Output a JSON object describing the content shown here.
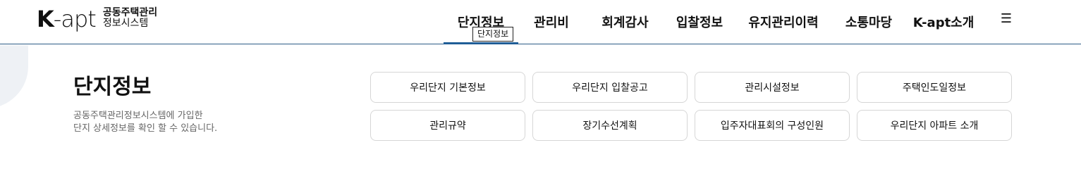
{
  "logo": {
    "mark_bold": "K",
    "mark_light": "-apt",
    "sub_line1": "공동주택관리",
    "sub_line2": "정보시스템"
  },
  "nav": {
    "items": [
      {
        "label": "단지정보"
      },
      {
        "label": "관리비"
      },
      {
        "label": "회계감사"
      },
      {
        "label": "입찰정보"
      },
      {
        "label": "유지관리이력"
      },
      {
        "label": "소통마당"
      },
      {
        "label": "K-apt소개"
      }
    ],
    "menu_icon": "☰",
    "tooltip": "단지정보"
  },
  "section": {
    "title": "단지정보",
    "desc_line1": "공동주택관리정보시스템에 가입한",
    "desc_line2": "단지 상세정보를 확인 할 수 있습니다."
  },
  "links": [
    "우리단지 기본정보",
    "우리단지 입찰공고",
    "관리시설정보",
    "주택인도일정보",
    "관리규약",
    "장기수선계획",
    "입주자대표회의 구성인원",
    "우리단지 아파트 소개"
  ]
}
